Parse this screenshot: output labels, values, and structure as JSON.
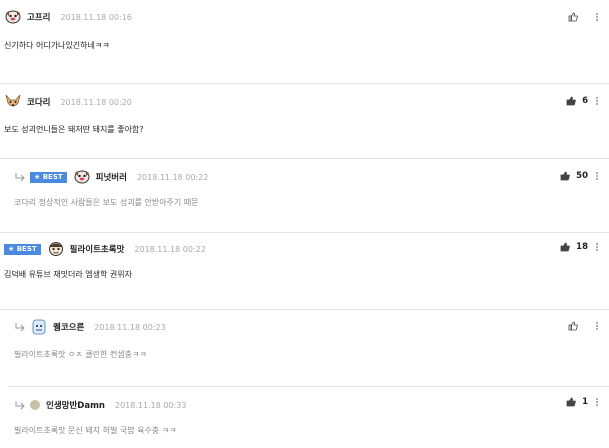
{
  "comments": [
    {
      "nick": "고프리",
      "date": "2018.11.18 00:16",
      "text": "신기하다 어디가나있긴하네ㅋㅋ",
      "count": "",
      "best": "",
      "avatar": "dog-face-icon"
    },
    {
      "nick": "코다리",
      "date": "2018.11.18 00:20",
      "text": "보도 성괴언니들은 돼저딴 돼지를 좋아함?",
      "count": "6",
      "best": "",
      "avatar": "fox-face-icon"
    },
    {
      "nick": "피넛버러",
      "date": "2018.11.18 00:22",
      "text": "코다리 정상적인 사람들은 보도 성괴를 안받아주기 때문",
      "count": "50",
      "best": "★ BEST",
      "avatar": "dog-face-icon"
    },
    {
      "nick": "필라이트초록맛",
      "date": "2018.11.18 00:22",
      "text": "김덕배 유튜브 재밋더라 엠생학 권위자",
      "count": "18",
      "best": "★ BEST",
      "avatar": "cartoon-face-icon"
    },
    {
      "nick": "퀭코으른",
      "date": "2018.11.18 00:23",
      "text": "필라이트초록맛 ㅇㅈ 클린한 컨셉충ㅋㅋ",
      "count": "",
      "best": "",
      "avatar": "character-icon"
    },
    {
      "nick": "인생망반Damn",
      "date": "2018.11.18 00:33",
      "text": "필라이트초록맛 문신 돼지 허벌 국밥 육수충 ㅋㅋ",
      "count": "1",
      "best": "",
      "avatar": "dot-avatar"
    }
  ],
  "colors": {
    "best_badge": "#4a8ae0",
    "date": "#aaaaaa",
    "reply_text": "#888888"
  }
}
